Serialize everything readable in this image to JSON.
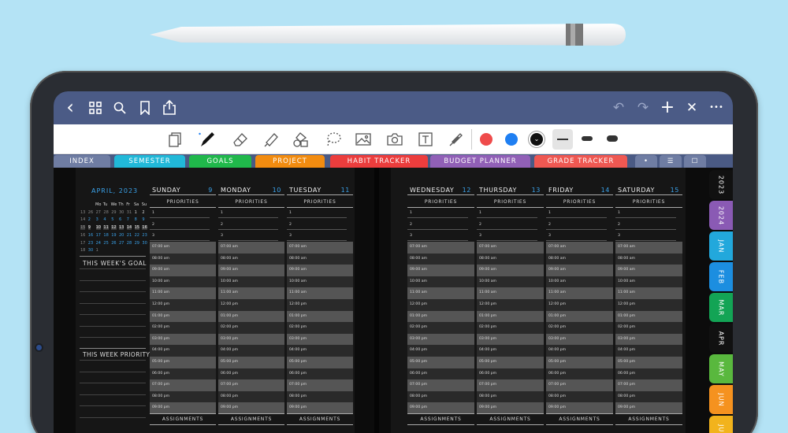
{
  "nav": {
    "undo": "↶",
    "redo": "↷",
    "add": "+",
    "close": "✕",
    "more": "•••",
    "back": "‹"
  },
  "colors": {
    "nav": "#4b5b86",
    "red": "#ef4b4b",
    "blue": "#1f7ff2",
    "black": "#111111",
    "active_bg": "#e4e4e4"
  },
  "tabs": [
    {
      "label": "INDEX",
      "color": "#6f7da3"
    },
    {
      "label": "SEMESTER",
      "color": "#21b8d8"
    },
    {
      "label": "GOALS",
      "color": "#20b84b"
    },
    {
      "label": "PROJECT",
      "color": "#f28c10"
    },
    {
      "label": "HABIT TRACKER",
      "color": "#ec3d3d"
    },
    {
      "label": "BUDGET PLANNER",
      "color": "#9160b7"
    },
    {
      "label": "GRADE TRACKER",
      "color": "#ef5852"
    }
  ],
  "tab_icons": [
    "•",
    "☰",
    "☐"
  ],
  "right_tabs": [
    {
      "label": "2023",
      "color": "#111111"
    },
    {
      "label": "2024",
      "color": "#8a5ab4"
    },
    {
      "label": "JAN",
      "color": "#22a8dc"
    },
    {
      "label": "FEB",
      "color": "#1c8ee0"
    },
    {
      "label": "MAR",
      "color": "#13a455"
    },
    {
      "label": "APR",
      "color": "#111111"
    },
    {
      "label": "MAY",
      "color": "#59b83e"
    },
    {
      "label": "JUN",
      "color": "#f5921f"
    },
    {
      "label": "JUL",
      "color": "#f2b31c"
    }
  ],
  "calendar": {
    "title": "APRIL, 2023",
    "rows": [
      [
        "Mo",
        "Tu",
        "We",
        "Th",
        "Fr",
        "Sa",
        "Su"
      ],
      [
        "13",
        "26",
        "27",
        "28",
        "29",
        "30",
        "31",
        "1",
        "2"
      ],
      [
        "14",
        "2",
        "3",
        "4",
        "5",
        "6",
        "7",
        "8",
        "9"
      ],
      [
        "15",
        "9",
        "10",
        "11",
        "12",
        "13",
        "14",
        "15",
        "16"
      ],
      [
        "16",
        "16",
        "17",
        "18",
        "19",
        "20",
        "21",
        "22",
        "23"
      ],
      [
        "17",
        "23",
        "24",
        "25",
        "26",
        "27",
        "28",
        "29",
        "30"
      ],
      [
        "18",
        "30",
        "1"
      ]
    ]
  },
  "side": {
    "goal": "THIS WEEK'S GOAL",
    "priority": "THIS WEEK PRIORITY"
  },
  "days_left": [
    {
      "name": "SUNDAY",
      "num": "9"
    },
    {
      "name": "MONDAY",
      "num": "10"
    },
    {
      "name": "TUESDAY",
      "num": "11"
    }
  ],
  "days_right": [
    {
      "name": "WEDNESDAY",
      "num": "12"
    },
    {
      "name": "THURSDAY",
      "num": "13"
    },
    {
      "name": "FRIDAY",
      "num": "14"
    },
    {
      "name": "SATURDAY",
      "num": "15"
    }
  ],
  "priorities_label": "PRIORITIES",
  "priority_numbers": [
    "1",
    "2",
    "3"
  ],
  "assignments_label": "ASSIGNMENTS",
  "times": [
    "07:00 am",
    "08:00 am",
    "09:00 am",
    "10:00 am",
    "11:00 am",
    "12:00 pm",
    "01:00 pm",
    "02:00 pm",
    "03:00 pm",
    "04:00 pm",
    "05:00 pm",
    "06:00 pm",
    "07:00 pm",
    "08:00 pm",
    "09:00 pm"
  ]
}
